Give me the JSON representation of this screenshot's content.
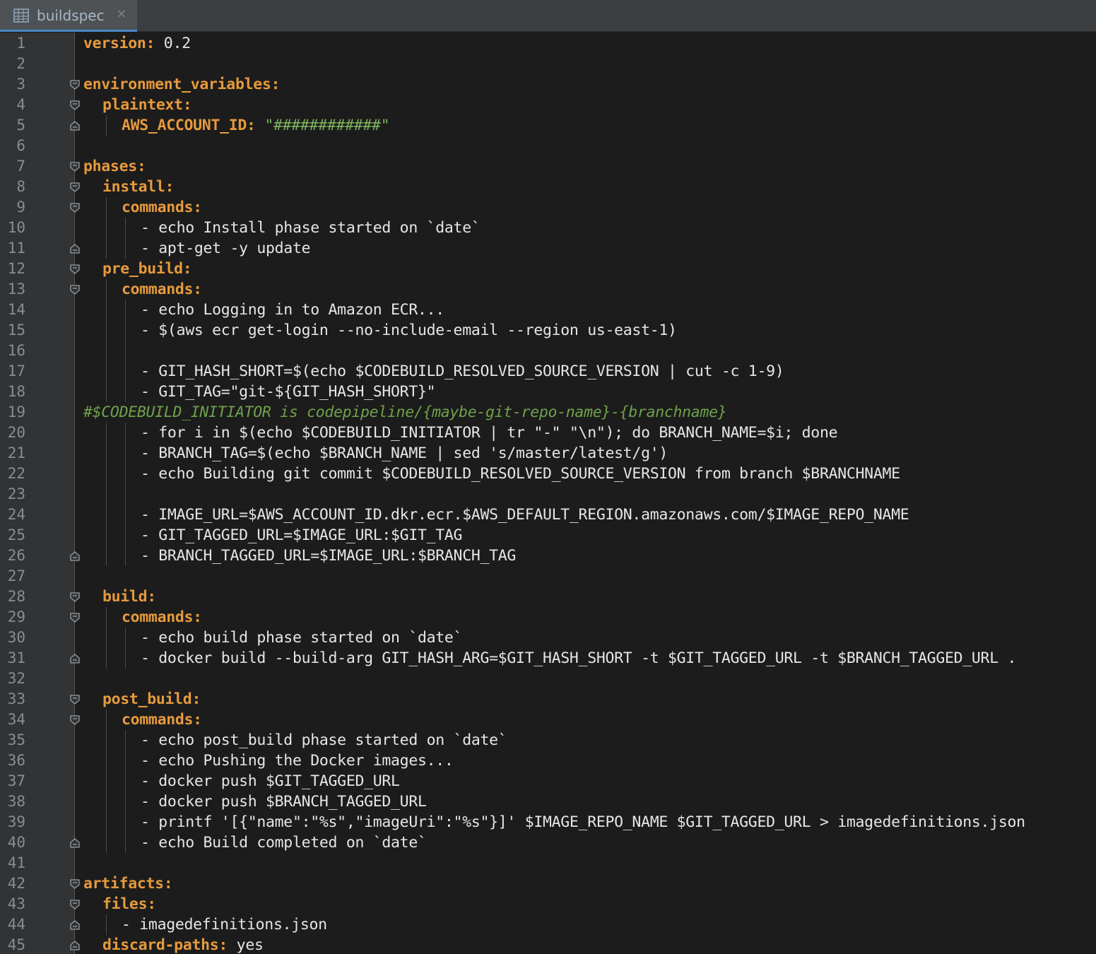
{
  "tab": {
    "label": "buildspec",
    "close_glyph": "✕",
    "icon": "table-file-icon"
  },
  "colors": {
    "key": "#e69a3c",
    "value": "#e6e6e6",
    "string": "#7eb35b",
    "comment": "#6fa24b",
    "background": "#1c1c1c",
    "gutter": "#313335"
  },
  "lines": [
    {
      "n": "1",
      "indent": 0,
      "fold": "",
      "guides": [],
      "segs": [
        {
          "t": "version:",
          "c": "key"
        },
        {
          "t": " 0.2",
          "c": "val"
        }
      ]
    },
    {
      "n": "2",
      "indent": 0,
      "fold": "",
      "guides": [],
      "segs": []
    },
    {
      "n": "3",
      "indent": 0,
      "fold": "open",
      "guides": [],
      "segs": [
        {
          "t": "environment_variables:",
          "c": "key"
        }
      ]
    },
    {
      "n": "4",
      "indent": 1,
      "fold": "open",
      "guides": [],
      "segs": [
        {
          "t": "plaintext:",
          "c": "key"
        }
      ]
    },
    {
      "n": "5",
      "indent": 2,
      "fold": "end",
      "guides": [
        1
      ],
      "segs": [
        {
          "t": "AWS_ACCOUNT_ID:",
          "c": "key"
        },
        {
          "t": " ",
          "c": "val"
        },
        {
          "t": "\"############\"",
          "c": "str"
        }
      ]
    },
    {
      "n": "6",
      "indent": 0,
      "fold": "",
      "guides": [],
      "segs": []
    },
    {
      "n": "7",
      "indent": 0,
      "fold": "open",
      "guides": [],
      "segs": [
        {
          "t": "phases:",
          "c": "key"
        }
      ]
    },
    {
      "n": "8",
      "indent": 1,
      "fold": "open",
      "guides": [],
      "segs": [
        {
          "t": "install:",
          "c": "key"
        }
      ]
    },
    {
      "n": "9",
      "indent": 2,
      "fold": "open",
      "guides": [
        1
      ],
      "segs": [
        {
          "t": "commands:",
          "c": "key"
        }
      ]
    },
    {
      "n": "10",
      "indent": 3,
      "fold": "",
      "guides": [
        1,
        2
      ],
      "segs": [
        {
          "t": "- echo Install phase started on `date`",
          "c": "val"
        }
      ]
    },
    {
      "n": "11",
      "indent": 3,
      "fold": "end",
      "guides": [
        1,
        2
      ],
      "segs": [
        {
          "t": "- apt-get -y update",
          "c": "val"
        }
      ]
    },
    {
      "n": "12",
      "indent": 1,
      "fold": "open",
      "guides": [],
      "segs": [
        {
          "t": "pre_build:",
          "c": "key"
        }
      ]
    },
    {
      "n": "13",
      "indent": 2,
      "fold": "open",
      "guides": [
        1
      ],
      "segs": [
        {
          "t": "commands:",
          "c": "key"
        }
      ]
    },
    {
      "n": "14",
      "indent": 3,
      "fold": "",
      "guides": [
        1,
        2
      ],
      "segs": [
        {
          "t": "- echo Logging in to Amazon ECR...",
          "c": "val"
        }
      ]
    },
    {
      "n": "15",
      "indent": 3,
      "fold": "",
      "guides": [
        1,
        2
      ],
      "segs": [
        {
          "t": "- $(aws ecr get-login --no-include-email --region us-east-1)",
          "c": "val"
        }
      ]
    },
    {
      "n": "16",
      "indent": 0,
      "fold": "",
      "guides": [
        1,
        2
      ],
      "segs": []
    },
    {
      "n": "17",
      "indent": 3,
      "fold": "",
      "guides": [
        1,
        2
      ],
      "segs": [
        {
          "t": "- GIT_HASH_SHORT=$(echo $CODEBUILD_RESOLVED_SOURCE_VERSION | cut -c 1-9)",
          "c": "val"
        }
      ]
    },
    {
      "n": "18",
      "indent": 3,
      "fold": "",
      "guides": [
        1,
        2
      ],
      "segs": [
        {
          "t": "- GIT_TAG=\"git-${GIT_HASH_SHORT}\"",
          "c": "val"
        }
      ]
    },
    {
      "n": "19",
      "indent": 0,
      "fold": "",
      "guides": [],
      "segs": [
        {
          "t": "#$CODEBUILD_INITIATOR is codepipeline/{maybe-git-repo-name}-{branchname}",
          "c": "comment"
        }
      ]
    },
    {
      "n": "20",
      "indent": 3,
      "fold": "",
      "guides": [
        1,
        2
      ],
      "segs": [
        {
          "t": "- for i in $(echo $CODEBUILD_INITIATOR | tr \"-\" \"\\n\"); do BRANCH_NAME=$i; done",
          "c": "val"
        }
      ]
    },
    {
      "n": "21",
      "indent": 3,
      "fold": "",
      "guides": [
        1,
        2
      ],
      "segs": [
        {
          "t": "- BRANCH_TAG=$(echo $BRANCH_NAME | sed 's/master/latest/g')",
          "c": "val"
        }
      ]
    },
    {
      "n": "22",
      "indent": 3,
      "fold": "",
      "guides": [
        1,
        2
      ],
      "segs": [
        {
          "t": "- echo Building git commit $CODEBUILD_RESOLVED_SOURCE_VERSION from branch $BRANCHNAME",
          "c": "val"
        }
      ]
    },
    {
      "n": "23",
      "indent": 0,
      "fold": "",
      "guides": [
        1,
        2
      ],
      "segs": []
    },
    {
      "n": "24",
      "indent": 3,
      "fold": "",
      "guides": [
        1,
        2
      ],
      "segs": [
        {
          "t": "- IMAGE_URL=$AWS_ACCOUNT_ID.dkr.ecr.$AWS_DEFAULT_REGION.amazonaws.com/$IMAGE_REPO_NAME",
          "c": "val"
        }
      ]
    },
    {
      "n": "25",
      "indent": 3,
      "fold": "",
      "guides": [
        1,
        2
      ],
      "segs": [
        {
          "t": "- GIT_TAGGED_URL=$IMAGE_URL:$GIT_TAG",
          "c": "val"
        }
      ]
    },
    {
      "n": "26",
      "indent": 3,
      "fold": "end",
      "guides": [
        1,
        2
      ],
      "segs": [
        {
          "t": "- BRANCH_TAGGED_URL=$IMAGE_URL:$BRANCH_TAG",
          "c": "val"
        }
      ]
    },
    {
      "n": "27",
      "indent": 0,
      "fold": "",
      "guides": [],
      "segs": []
    },
    {
      "n": "28",
      "indent": 1,
      "fold": "open",
      "guides": [],
      "segs": [
        {
          "t": "build:",
          "c": "key"
        }
      ]
    },
    {
      "n": "29",
      "indent": 2,
      "fold": "open",
      "guides": [
        1
      ],
      "segs": [
        {
          "t": "commands:",
          "c": "key"
        }
      ]
    },
    {
      "n": "30",
      "indent": 3,
      "fold": "",
      "guides": [
        1,
        2
      ],
      "segs": [
        {
          "t": "- echo build phase started on `date`",
          "c": "val"
        }
      ]
    },
    {
      "n": "31",
      "indent": 3,
      "fold": "end",
      "guides": [
        1,
        2
      ],
      "segs": [
        {
          "t": "- docker build --build-arg GIT_HASH_ARG=$GIT_HASH_SHORT -t $GIT_TAGGED_URL -t $BRANCH_TAGGED_URL .",
          "c": "val"
        }
      ]
    },
    {
      "n": "32",
      "indent": 0,
      "fold": "",
      "guides": [],
      "segs": []
    },
    {
      "n": "33",
      "indent": 1,
      "fold": "open",
      "guides": [],
      "segs": [
        {
          "t": "post_build:",
          "c": "key"
        }
      ]
    },
    {
      "n": "34",
      "indent": 2,
      "fold": "open",
      "guides": [
        1
      ],
      "segs": [
        {
          "t": "commands:",
          "c": "key"
        }
      ]
    },
    {
      "n": "35",
      "indent": 3,
      "fold": "",
      "guides": [
        1,
        2
      ],
      "segs": [
        {
          "t": "- echo post_build phase started on `date`",
          "c": "val"
        }
      ]
    },
    {
      "n": "36",
      "indent": 3,
      "fold": "",
      "guides": [
        1,
        2
      ],
      "segs": [
        {
          "t": "- echo Pushing the Docker images...",
          "c": "val"
        }
      ]
    },
    {
      "n": "37",
      "indent": 3,
      "fold": "",
      "guides": [
        1,
        2
      ],
      "segs": [
        {
          "t": "- docker push $GIT_TAGGED_URL",
          "c": "val"
        }
      ]
    },
    {
      "n": "38",
      "indent": 3,
      "fold": "",
      "guides": [
        1,
        2
      ],
      "segs": [
        {
          "t": "- docker push $BRANCH_TAGGED_URL",
          "c": "val"
        }
      ]
    },
    {
      "n": "39",
      "indent": 3,
      "fold": "",
      "guides": [
        1,
        2
      ],
      "segs": [
        {
          "t": "- printf '[{\"name\":\"%s\",\"imageUri\":\"%s\"}]' $IMAGE_REPO_NAME $GIT_TAGGED_URL > imagedefinitions.json",
          "c": "val"
        }
      ]
    },
    {
      "n": "40",
      "indent": 3,
      "fold": "end",
      "guides": [
        1,
        2
      ],
      "segs": [
        {
          "t": "- echo Build completed on `date`",
          "c": "val"
        }
      ]
    },
    {
      "n": "41",
      "indent": 0,
      "fold": "",
      "guides": [],
      "segs": []
    },
    {
      "n": "42",
      "indent": 0,
      "fold": "open",
      "guides": [],
      "segs": [
        {
          "t": "artifacts:",
          "c": "key"
        }
      ]
    },
    {
      "n": "43",
      "indent": 1,
      "fold": "open",
      "guides": [],
      "segs": [
        {
          "t": "files:",
          "c": "key"
        }
      ]
    },
    {
      "n": "44",
      "indent": 2,
      "fold": "end",
      "guides": [
        1
      ],
      "segs": [
        {
          "t": "- imagedefinitions.json",
          "c": "val"
        }
      ]
    },
    {
      "n": "45",
      "indent": 1,
      "fold": "end",
      "guides": [],
      "segs": [
        {
          "t": "discard-paths:",
          "c": "key"
        },
        {
          "t": " yes",
          "c": "val"
        }
      ]
    }
  ]
}
